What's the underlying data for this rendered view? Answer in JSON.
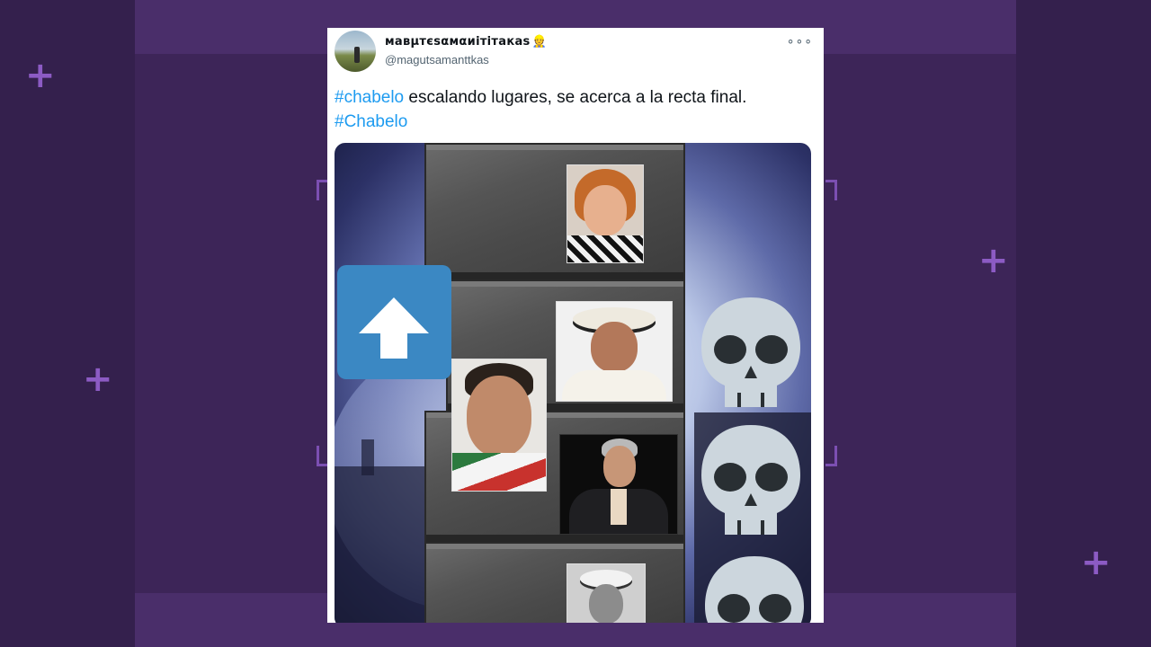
{
  "tweet": {
    "display_name": "мавμтєѕαмαиітітакаѕ",
    "display_emoji": "👷",
    "handle": "@magutsamanttkas",
    "more_menu_glyph": "∘∘∘",
    "text_hashtag_1": "#chabelo",
    "text_body": " escalando lugares, se acerca a la recta final.",
    "text_hashtag_2": "#Chabelo"
  },
  "media": {
    "arrow_color": "#3b88c3",
    "skull_color": "#ccd6dd",
    "skull_count": 3
  },
  "colors": {
    "background": "#3d2558",
    "accent_plus": "#8c5bc4",
    "hashtag": "#1d9bf0"
  }
}
